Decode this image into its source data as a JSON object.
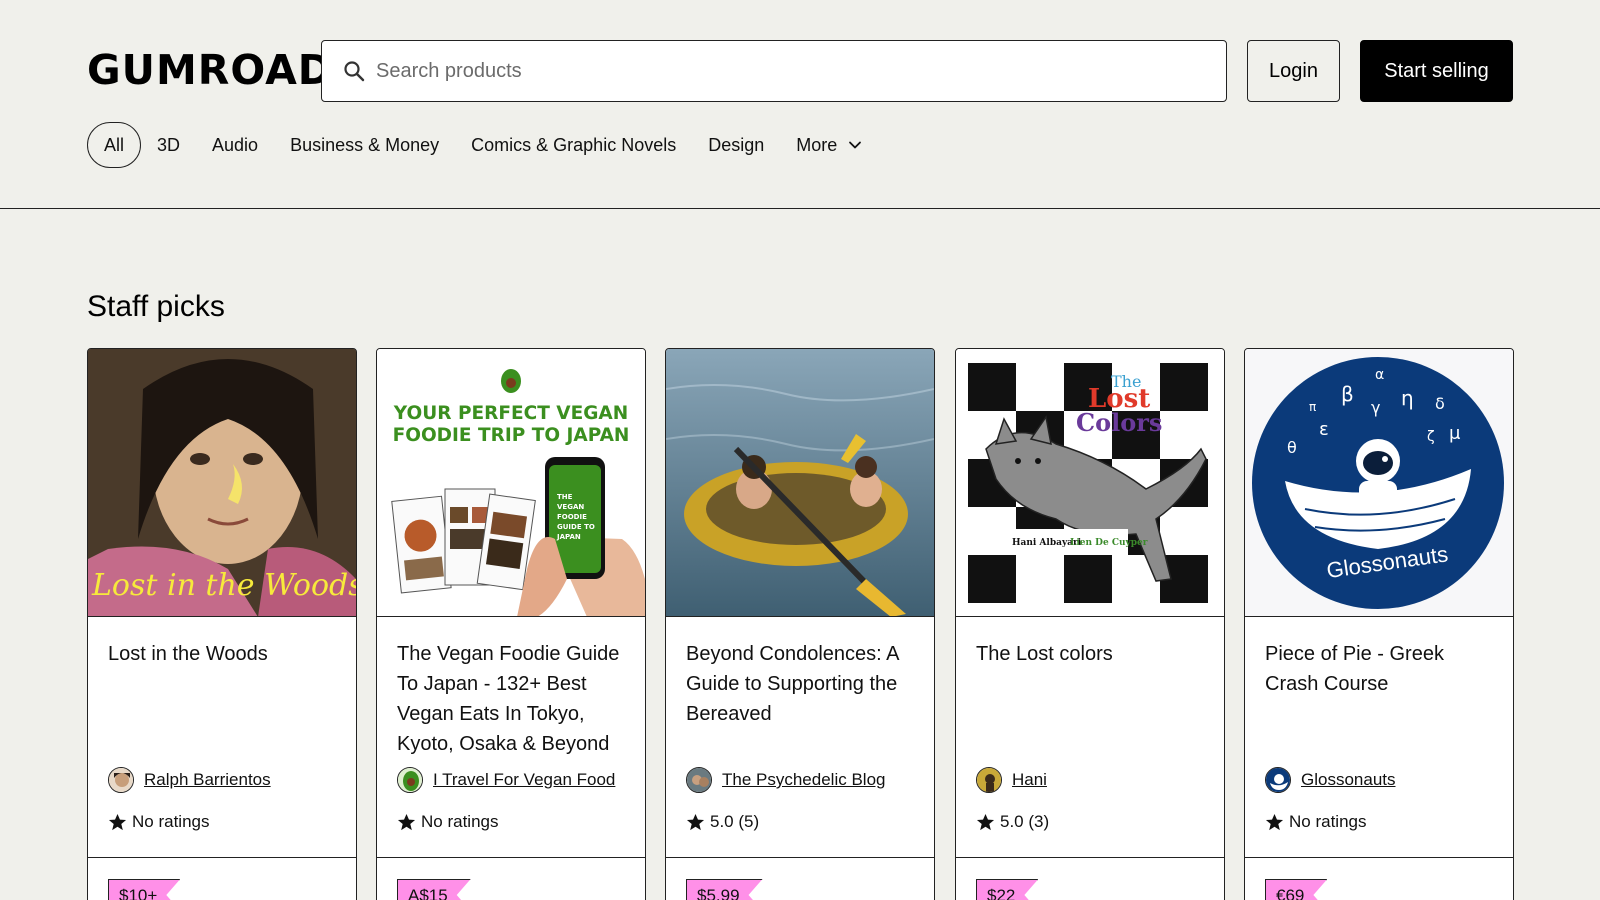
{
  "brand": {
    "logo_text": "GUMROAD"
  },
  "header": {
    "search_placeholder": "Search products",
    "login_label": "Login",
    "start_selling_label": "Start selling"
  },
  "categories": [
    {
      "label": "All",
      "active": true
    },
    {
      "label": "3D"
    },
    {
      "label": "Audio"
    },
    {
      "label": "Business & Money"
    },
    {
      "label": "Comics & Graphic Novels"
    },
    {
      "label": "Design"
    },
    {
      "label": "More"
    }
  ],
  "staff_picks": {
    "title": "Staff picks",
    "cards": [
      {
        "title": "Lost in the Woods",
        "creator": "Ralph Barrientos",
        "rating": "No ratings",
        "price": "$10+",
        "cover_text": "Lost in the Woods"
      },
      {
        "title": "The Vegan Foodie Guide To Japan - 132+ Best Vegan Eats In Tokyo, Kyoto, Osaka & Beyond",
        "creator": "I Travel For Vegan Food",
        "rating": "No ratings",
        "price": "A$15",
        "cover_line_1": "YOUR PERFECT VEGAN",
        "cover_line_2": "FOODIE TRIP TO JAPAN"
      },
      {
        "title": "Beyond Condolences: A Guide to Supporting the Bereaved",
        "creator": "The Psychedelic Blog",
        "rating": "5.0 (5)",
        "price": "$5.99"
      },
      {
        "title": "The Lost colors",
        "creator": "Hani",
        "rating": "5.0 (3)",
        "price": "$22",
        "cover_the": "The",
        "cover_lost": "Lost",
        "cover_colors": "Colors",
        "cover_author_1": "Hani Albayari",
        "cover_author_2": "Lien De Cuyper"
      },
      {
        "title": "Piece of Pie - Greek Crash Course",
        "creator": "Glossonauts",
        "rating": "No ratings",
        "price": "€69",
        "cover_text": "Glossonauts"
      }
    ]
  },
  "colors": {
    "background": "#f0f0eb",
    "price_tag": "#ff90e8",
    "card_border": "#222222",
    "glossonauts_blue": "#0b3a7a",
    "vegan_green": "#3b8f1f"
  },
  "icons": {
    "search": "search-icon",
    "chevron": "chevron-down-icon",
    "star": "star-icon"
  }
}
